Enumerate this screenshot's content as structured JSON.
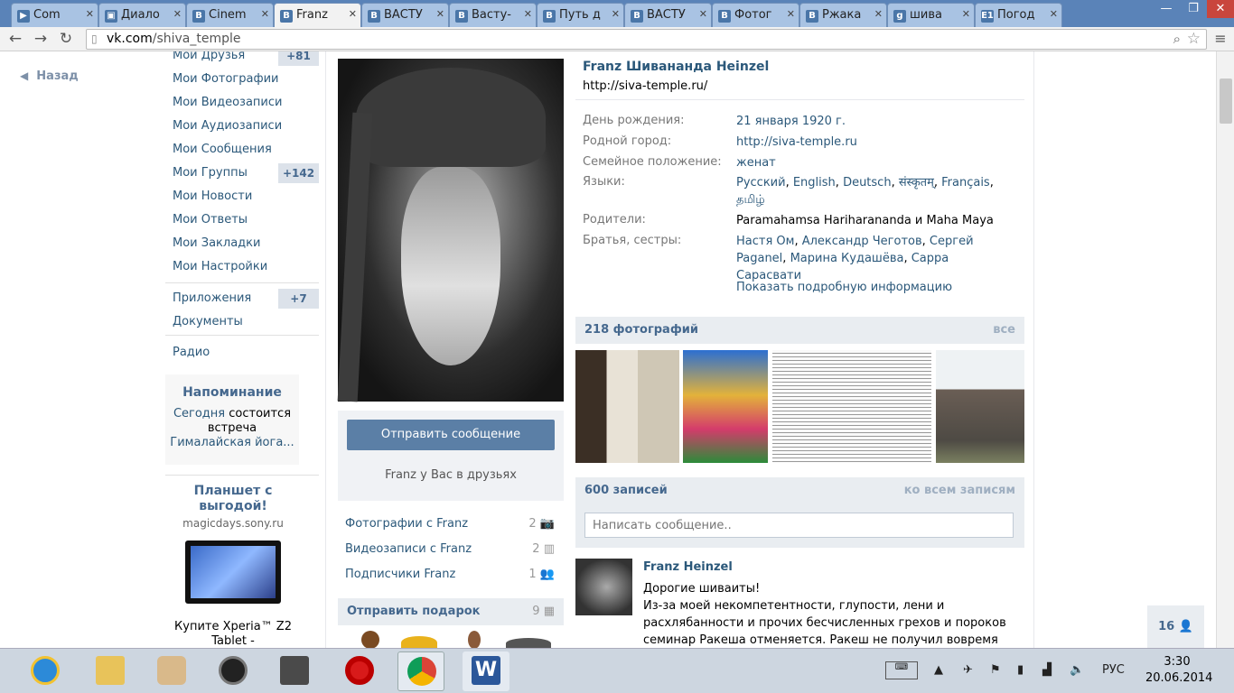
{
  "tabs": [
    {
      "label": "Com",
      "fav": "▶"
    },
    {
      "label": "Диало",
      "fav": "▣"
    },
    {
      "label": "Cinem",
      "fav": "B"
    },
    {
      "label": "Franz",
      "fav": "B"
    },
    {
      "label": "ВАСТУ",
      "fav": "B"
    },
    {
      "label": "Васту-",
      "fav": "B"
    },
    {
      "label": "Путь д",
      "fav": "B"
    },
    {
      "label": "ВАСТУ",
      "fav": "B"
    },
    {
      "label": "Фотог",
      "fav": "B"
    },
    {
      "label": "Ржака",
      "fav": "B"
    },
    {
      "label": "шива",
      "fav": "g"
    },
    {
      "label": "Погод",
      "fav": "E1"
    }
  ],
  "address": {
    "host": "vk.com",
    "path": "/shiva_temple"
  },
  "back_label": "Назад",
  "menu": [
    {
      "label": "Мои Друзья",
      "badge": "+81"
    },
    {
      "label": "Мои Фотографии"
    },
    {
      "label": "Мои Видеозаписи"
    },
    {
      "label": "Мои Аудиозаписи"
    },
    {
      "label": "Мои Сообщения"
    },
    {
      "label": "Мои Группы",
      "badge": "+142"
    },
    {
      "label": "Мои Новости"
    },
    {
      "label": "Мои Ответы"
    },
    {
      "label": "Мои Закладки"
    },
    {
      "label": "Мои Настройки"
    },
    {
      "label": "Приложения",
      "badge": "+7"
    },
    {
      "label": "Документы"
    },
    {
      "label": "Радио"
    }
  ],
  "reminder": {
    "title": "Напоминание",
    "link1": "Сегодня",
    "text": "состоится встреча",
    "link2": "Гималайская йога..."
  },
  "ad": {
    "title": "Планшет с выгодой!",
    "domain": "magicdays.sony.ru",
    "caption": "Купите Xperia™ Z2 Tablet -"
  },
  "profile": {
    "name": "Franz Шивананда Heinzel",
    "status": "http://siva-temple.ru/",
    "send_message": "Отправить сообщение",
    "friends_note": "Franz у Вас в друзьях",
    "birthday_label": "День рождения:",
    "birthday": "21 января 1920 г.",
    "hometown_label": "Родной город:",
    "hometown": "http://siva-temple.ru",
    "family_label": "Семейное положение:",
    "family": "женат",
    "languages_label": "Языки:",
    "languages": [
      "Русский",
      "English",
      "Deutsch",
      "संस्कृतम्",
      "Français",
      "தமிழ்"
    ],
    "parents_label": "Родители:",
    "parents": "Paramahamsa Hariharananda и Maha Maya",
    "siblings_label": "Братья, сестры:",
    "siblings": [
      "Настя Ом",
      "Александр Чеготов",
      "Сергей Paganel",
      "Марина Кудашёва",
      "Сарра Сарасвати"
    ],
    "more_info": "Показать подробную информацию"
  },
  "links": [
    {
      "label": "Фотографии с Franz",
      "count": "2"
    },
    {
      "label": "Видеозаписи с Franz",
      "count": "2"
    },
    {
      "label": "Подписчики Franz",
      "count": "1"
    }
  ],
  "gift": {
    "label": "Отправить подарок",
    "count": "9"
  },
  "photos": {
    "title": "218 фотографий",
    "all": "все"
  },
  "wall": {
    "title": "600 записей",
    "all": "ко всем записям",
    "placeholder": "Написать сообщение.."
  },
  "post": {
    "author": "Franz Heinzel",
    "line1": "Дорогие шиваиты!",
    "line2": "Из-за моей некомпетентности, глупости, лени и",
    "line3": "расхлябанности и прочих бесчисленных грехов и пороков",
    "line4": "семинар Ракеша отменяется. Ракеш не получил вовремя визу,"
  },
  "online": {
    "count": "16"
  },
  "tray": {
    "lang": "РУС",
    "time": "3:30",
    "date": "20.06.2014"
  },
  "colors": {
    "vk_link": "#2b587a",
    "vk_header": "#45688e",
    "tab_bar": "#5a83b8",
    "button": "#5b7fa6"
  }
}
